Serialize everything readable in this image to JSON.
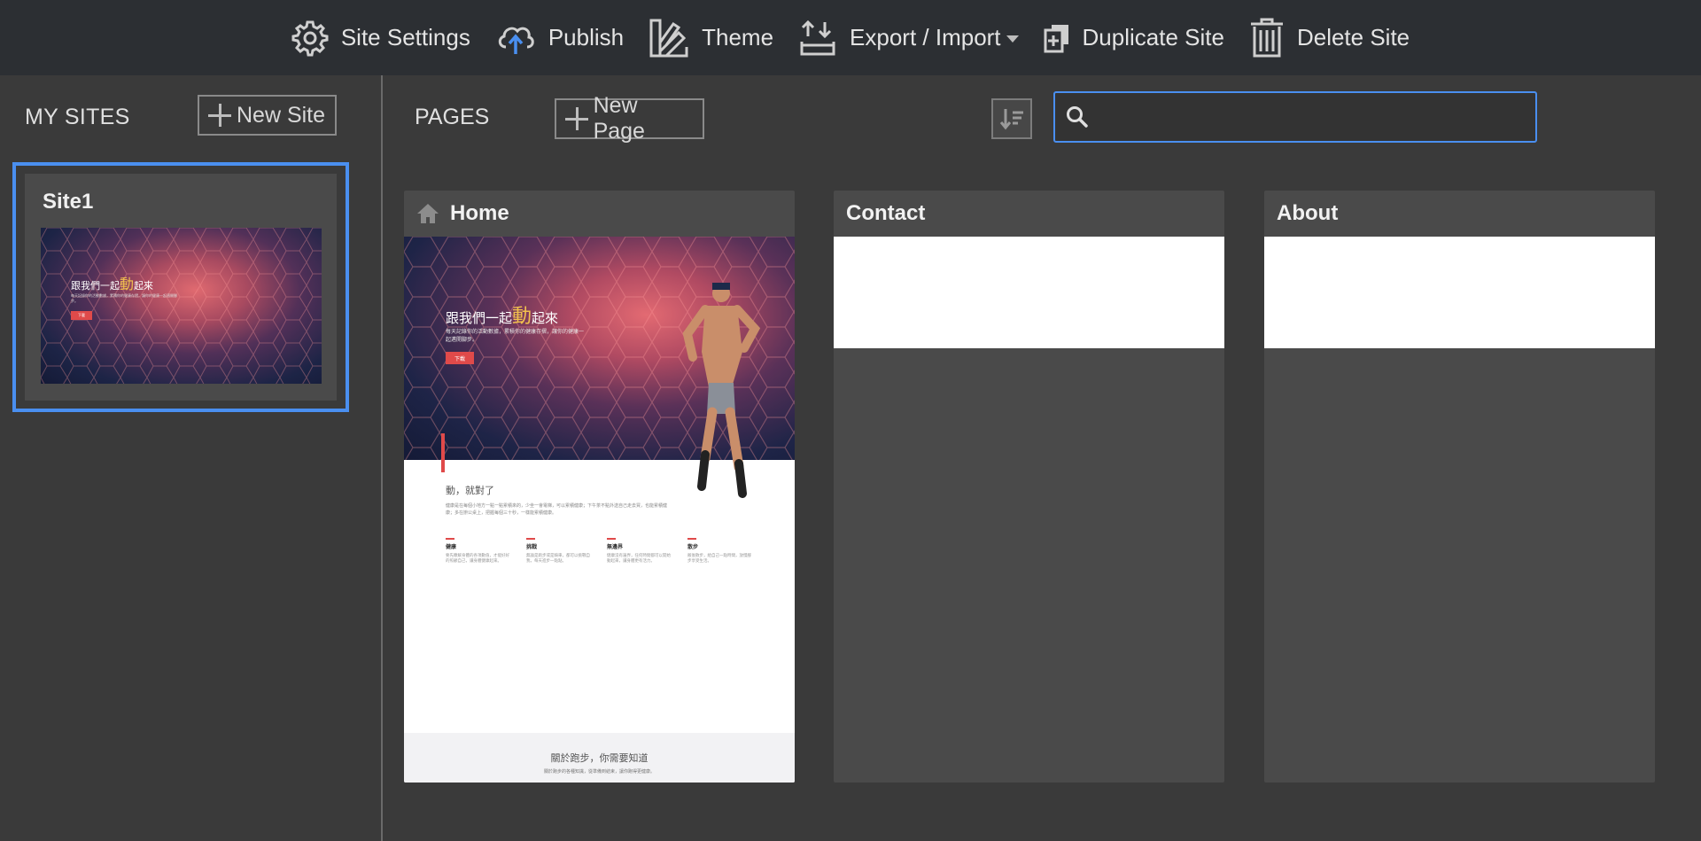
{
  "toolbar": {
    "site_settings": "Site Settings",
    "publish": "Publish",
    "theme": "Theme",
    "export_import": "Export / Import",
    "duplicate_site": "Duplicate Site",
    "delete_site": "Delete Site"
  },
  "sidebar": {
    "title": "MY SITES",
    "new_site": "New Site",
    "sites": [
      {
        "name": "Site1",
        "thumb_heading_pre": "跟我們一起",
        "thumb_heading_accent": "動",
        "thumb_heading_post": "起來",
        "thumb_sub": "每天記錄你的活動數據，累積你的健康存摺，讓你的健康一起邁開腳步。",
        "thumb_button": "下載"
      }
    ]
  },
  "pages": {
    "title": "PAGES",
    "new_page": "New Page",
    "search_value": "",
    "items": [
      {
        "name": "Home"
      },
      {
        "name": "Contact"
      },
      {
        "name": "About"
      }
    ]
  },
  "home_preview": {
    "hero_pre": "跟我們一起",
    "hero_accent": "動",
    "hero_post": "起來",
    "hero_sub": "每天記錄你的活動數據，累積你的健康存摺，讓你的健康一起邁開腳步。",
    "hero_button": "下載",
    "section_title": "動，就對了",
    "section_text": "健康是在每個小地方一點一點累積來的，少坐一會電梯，可以累積健康；下午茶不點外送自己走去買，也能累積健康；多在辦公桌上，把握每個三十秒，一樣能累積健康。",
    "columns": [
      {
        "title": "健康",
        "text": "要先瞭解身體的各項數值，才能好好的照顧自己，讓身體健康起來。"
      },
      {
        "title": "挑戰",
        "text": "無論是跑步或是騎車，都可以挑戰自我，每天進步一點點。"
      },
      {
        "title": "無邊界",
        "text": "健康沒有邊界，任何時間都可以開始動起來，讓身體更有活力。"
      },
      {
        "title": "散步",
        "text": "飯後散步，給自己一點時間，放慢腳步享受生活。"
      }
    ],
    "footer_title": "關於跑步，你需要知道",
    "footer_sub": "關於跑步的各種知識，從準備到結束，讓你跑得更健康。"
  },
  "colors": {
    "topbar_bg": "#2c2f33",
    "body_bg": "#3a3a3a",
    "card_bg": "#4a4a4a",
    "accent_blue": "#4a8ff0",
    "publish_arrow": "#4a8ff0",
    "hero_accent": "#f2c14e",
    "cta_red": "#e04a4a"
  },
  "icons": {
    "site_settings": "gear-icon",
    "publish": "cloud-upload-icon",
    "theme": "swatch-icon",
    "export_import": "export-import-icon",
    "duplicate_site": "duplicate-icon",
    "delete_site": "trash-icon",
    "sort": "sort-icon",
    "search": "search-icon",
    "home": "home-icon"
  }
}
